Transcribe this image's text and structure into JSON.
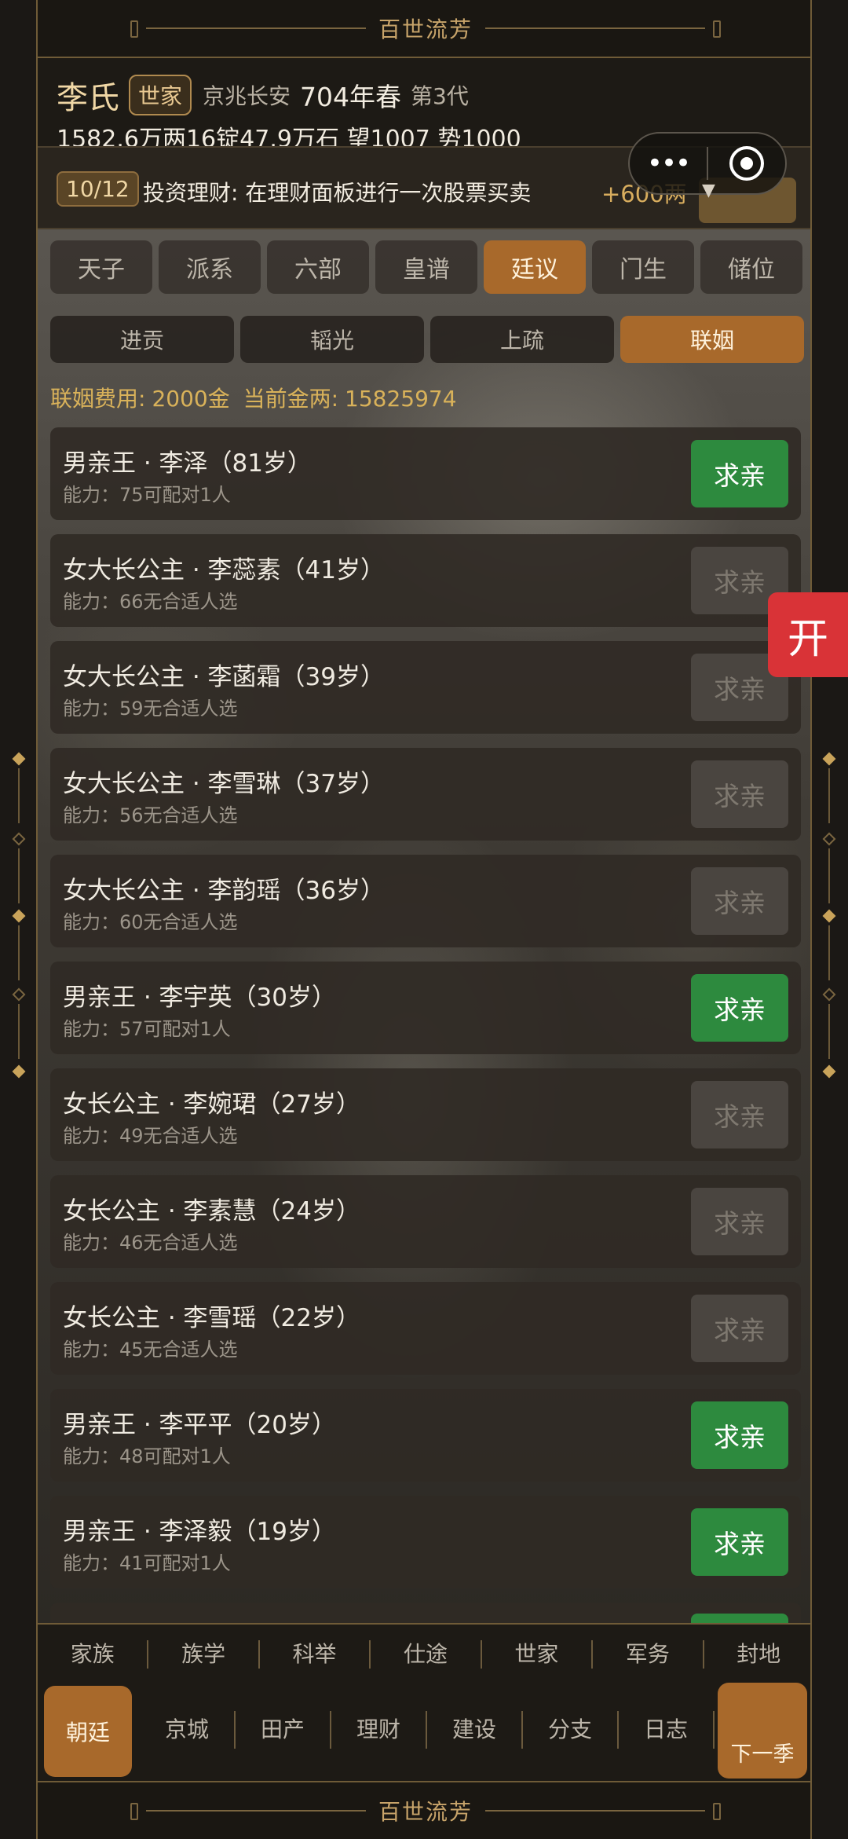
{
  "banner": {
    "title": "百世流芳"
  },
  "header": {
    "clan_name": "李氏",
    "clan_rank": "世家",
    "location": "京兆长安",
    "year": "704年春",
    "generation": "第3代",
    "stats": "1582.6万两16锭47.9万石  望1007 势1000"
  },
  "capsule": {
    "menu_icon": "more-dots-icon",
    "close_icon": "target-icon"
  },
  "task": {
    "progress": "10/12",
    "text": "投资理财: 在理财面板进行一次股票买卖",
    "reward": "+600两"
  },
  "tabs_primary": [
    {
      "label": "天子"
    },
    {
      "label": "派系"
    },
    {
      "label": "六部"
    },
    {
      "label": "皇谱"
    },
    {
      "label": "廷议",
      "active": true
    },
    {
      "label": "门生"
    },
    {
      "label": "储位"
    }
  ],
  "tabs_secondary": [
    {
      "label": "进贡"
    },
    {
      "label": "韬光"
    },
    {
      "label": "上疏"
    },
    {
      "label": "联姻",
      "active": true
    }
  ],
  "fee": {
    "fee_label": "联姻费用:",
    "fee_value": "2000金",
    "gold_label": "当前金两:",
    "gold_value": "15825974"
  },
  "candidates": [
    {
      "name": "男亲王 · 李泽（81岁）",
      "detail": "能力：75可配对1人",
      "button": "求亲",
      "enabled": true
    },
    {
      "name": "女大长公主 · 李蕊素（41岁）",
      "detail": "能力：66无合适人选",
      "button": "求亲",
      "enabled": false
    },
    {
      "name": "女大长公主 · 李菡霜（39岁）",
      "detail": "能力：59无合适人选",
      "button": "求亲",
      "enabled": false
    },
    {
      "name": "女大长公主 · 李雪琳（37岁）",
      "detail": "能力：56无合适人选",
      "button": "求亲",
      "enabled": false
    },
    {
      "name": "女大长公主 · 李韵瑶（36岁）",
      "detail": "能力：60无合适人选",
      "button": "求亲",
      "enabled": false
    },
    {
      "name": "男亲王 · 李宇英（30岁）",
      "detail": "能力：57可配对1人",
      "button": "求亲",
      "enabled": true
    },
    {
      "name": "女长公主 · 李婉珺（27岁）",
      "detail": "能力：49无合适人选",
      "button": "求亲",
      "enabled": false
    },
    {
      "name": "女长公主 · 李素慧（24岁）",
      "detail": "能力：46无合适人选",
      "button": "求亲",
      "enabled": false
    },
    {
      "name": "女长公主 · 李雪瑶（22岁）",
      "detail": "能力：45无合适人选",
      "button": "求亲",
      "enabled": false
    },
    {
      "name": "男亲王 · 李平平（20岁）",
      "detail": "能力：48可配对1人",
      "button": "求亲",
      "enabled": true
    },
    {
      "name": "男亲王 · 李泽毅（19岁）",
      "detail": "能力：41可配对1人",
      "button": "求亲",
      "enabled": true
    }
  ],
  "nav_row1": [
    {
      "label": "家族"
    },
    {
      "label": "族学"
    },
    {
      "label": "科举"
    },
    {
      "label": "仕途"
    },
    {
      "label": "世家"
    },
    {
      "label": "军务"
    },
    {
      "label": "封地"
    }
  ],
  "nav_row2": {
    "home": "朝廷",
    "items": [
      {
        "label": "京城"
      },
      {
        "label": "田产"
      },
      {
        "label": "理财"
      },
      {
        "label": "建设"
      },
      {
        "label": "分支"
      },
      {
        "label": "日志"
      }
    ],
    "next": "下一季"
  },
  "float_button": "开",
  "colors": {
    "accent": "#a8692b",
    "enabled_button": "#2d8a3e",
    "gold_text": "#d9b25a"
  }
}
